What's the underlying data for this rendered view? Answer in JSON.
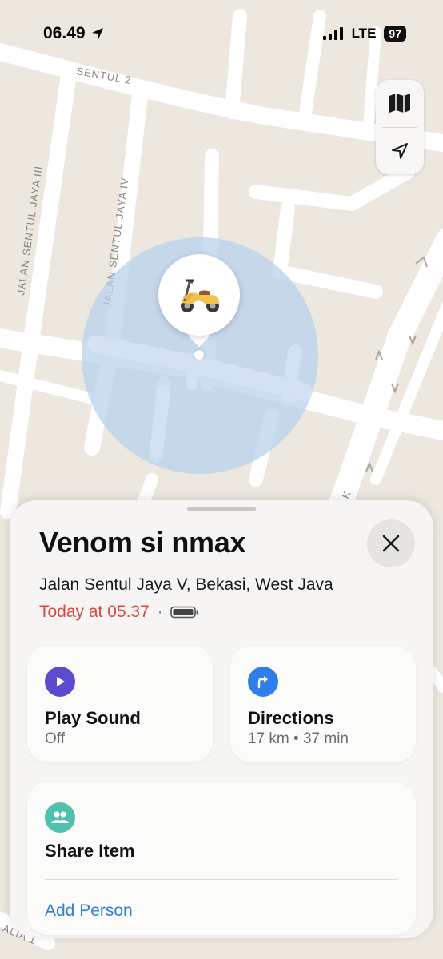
{
  "status_bar": {
    "time": "06.49",
    "network": "LTE",
    "battery": "97"
  },
  "map": {
    "street_labels": [
      "SENTUL 2",
      "JALAN SENTUL JAYA III",
      "JALAN SENTUL JAYA IV",
      "K",
      "ALIA 1"
    ],
    "controls": {
      "map_mode_icon": "map-icon",
      "locate_icon": "location-arrow-icon"
    },
    "item_icon": "scooter"
  },
  "sheet": {
    "title": "Venom si nmax",
    "address": "Jalan Sentul Jaya V, Bekasi, West Java",
    "last_seen": "Today at 05.37",
    "separator": "·",
    "actions": {
      "play_sound": {
        "title": "Play Sound",
        "subtitle": "Off",
        "icon": "play-icon",
        "color": "#5b4ccf"
      },
      "directions": {
        "title": "Directions",
        "subtitle": "17 km • 37 min",
        "icon": "directions-arrow-icon",
        "color": "#2f7fe8"
      },
      "share": {
        "title": "Share Item",
        "action": "Add Person",
        "icon": "people-icon",
        "color": "#4fc1ad"
      }
    }
  },
  "colors": {
    "accent_blue": "#2f7fd8",
    "time_red": "#d9473f",
    "accuracy_circle": "#b8d1ec"
  }
}
